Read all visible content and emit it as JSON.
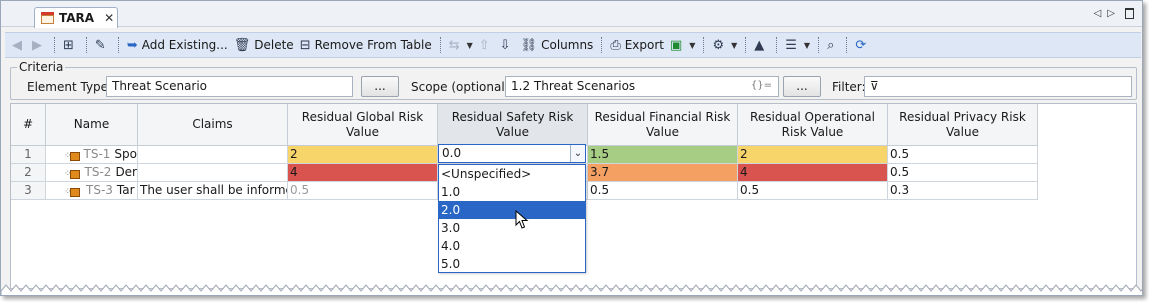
{
  "window": {
    "tab_title": "TARA",
    "tab_close_glyph": "✕",
    "tab_icon": "table-icon"
  },
  "toolbar": {
    "add_existing": "Add Existing...",
    "delete": "Delete",
    "remove_from_table": "Remove From Table",
    "columns": "Columns",
    "export": "Export"
  },
  "criteria": {
    "legend": "Criteria",
    "element_type_label": "Element Type:",
    "element_type_value": "Threat Scenario",
    "browse_label": "...",
    "scope_label": "Scope (optional):",
    "scope_value": "1.2 Threat Scenarios",
    "scope_regex": "{}=",
    "filter_label": "Filter:"
  },
  "table": {
    "columns": [
      "#",
      "Name",
      "Claims",
      "Residual Global Risk Value",
      "Residual Safety Risk Value",
      "Residual Financial Risk Value",
      "Residual Operational Risk Value",
      "Residual Privacy Risk Value"
    ],
    "rows": [
      {
        "num": "1",
        "id": "TS-1",
        "name": "Spo",
        "claims": "",
        "global": "2",
        "safety": "0.0",
        "financial": "1.5",
        "operational": "2",
        "privacy": "0.5"
      },
      {
        "num": "2",
        "id": "TS-2",
        "name": "Der",
        "claims": "",
        "global": "4",
        "safety": "",
        "financial": "3.7",
        "operational": "4",
        "privacy": "0.5"
      },
      {
        "num": "3",
        "id": "TS-3",
        "name": "Tar",
        "claims": "The user shall be informed f",
        "global": "0.5",
        "safety": "",
        "financial": "0.5",
        "operational": "0.5",
        "privacy": "0.3"
      }
    ],
    "cell_colors": {
      "yellow": "#f8d56b",
      "red": "#d9534f",
      "green": "#a7cc83",
      "orange": "#f3a062"
    }
  },
  "editor": {
    "current_value": "0.0",
    "options": [
      "<Unspecified>",
      "1.0",
      "2.0",
      "3.0",
      "4.0",
      "5.0"
    ],
    "highlighted_option": "2.0"
  }
}
